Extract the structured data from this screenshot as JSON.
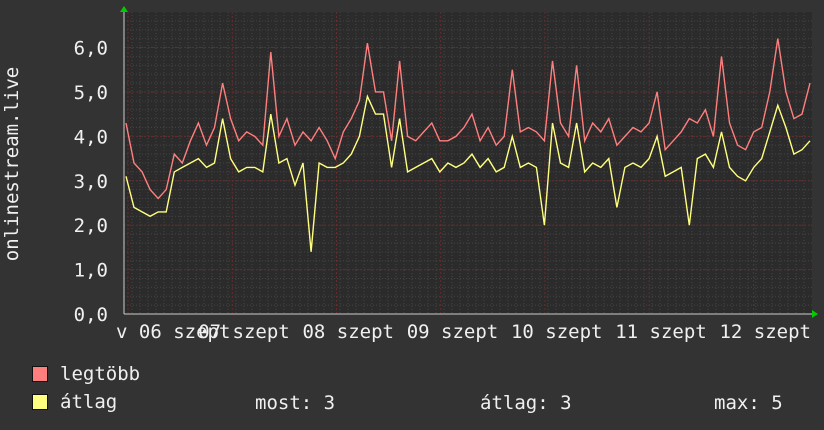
{
  "colors": {
    "background": "#333333",
    "plot_background": "#2b2b2b",
    "grid_major": "#6a2a2a",
    "grid_minor": "#444444",
    "axis_arrow": "#00cc00",
    "series_max": "#ff7f7f",
    "series_avg": "#ffff7f",
    "text": "#f0f0f0"
  },
  "chart_data": {
    "type": "line",
    "ylabel": "onlinestream.live",
    "ylim": [
      0,
      6.8
    ],
    "y_ticks": [
      "0,0",
      "1,0",
      "2,0",
      "3,0",
      "4,0",
      "5,0",
      "6,0"
    ],
    "y_tick_values": [
      0,
      1,
      2,
      3,
      4,
      5,
      6
    ],
    "x_tick_labels": [
      "v 06 szept",
      "07 szept",
      "08 szept",
      "09 szept",
      "10 szept",
      "11 szept",
      "12 szept"
    ],
    "grid": true,
    "series": [
      {
        "name": "legtöbb",
        "color": "#ff7f7f",
        "values": [
          4.3,
          3.4,
          3.2,
          2.8,
          2.6,
          2.8,
          3.6,
          3.4,
          3.9,
          4.3,
          3.8,
          4.2,
          5.2,
          4.4,
          3.9,
          4.1,
          4.0,
          3.8,
          5.9,
          4.0,
          4.4,
          3.8,
          4.1,
          3.9,
          4.2,
          3.9,
          3.5,
          4.1,
          4.4,
          4.8,
          6.1,
          5.0,
          5.0,
          3.9,
          5.7,
          4.0,
          3.9,
          4.1,
          4.3,
          3.9,
          3.9,
          4.0,
          4.2,
          4.5,
          3.9,
          4.2,
          3.8,
          4.0,
          5.5,
          4.1,
          4.2,
          4.1,
          3.9,
          5.7,
          4.3,
          4.0,
          5.6,
          3.9,
          4.3,
          4.1,
          4.4,
          3.8,
          4.0,
          4.2,
          4.1,
          4.3,
          5.0,
          3.7,
          3.9,
          4.1,
          4.4,
          4.3,
          4.6,
          4.0,
          5.8,
          4.3,
          3.8,
          3.7,
          4.1,
          4.2,
          5.0,
          6.2,
          5.0,
          4.4,
          4.5,
          5.2
        ]
      },
      {
        "name": "átlag",
        "color": "#ffff7f",
        "values": [
          3.1,
          2.4,
          2.3,
          2.2,
          2.3,
          2.3,
          3.2,
          3.3,
          3.4,
          3.5,
          3.3,
          3.4,
          4.4,
          3.5,
          3.2,
          3.3,
          3.3,
          3.2,
          4.5,
          3.4,
          3.5,
          2.9,
          3.4,
          1.4,
          3.4,
          3.3,
          3.3,
          3.4,
          3.6,
          4.0,
          4.9,
          4.5,
          4.5,
          3.3,
          4.4,
          3.2,
          3.3,
          3.4,
          3.5,
          3.2,
          3.4,
          3.3,
          3.4,
          3.6,
          3.3,
          3.5,
          3.2,
          3.3,
          4.0,
          3.3,
          3.4,
          3.3,
          2.0,
          4.3,
          3.4,
          3.3,
          4.3,
          3.2,
          3.4,
          3.3,
          3.5,
          2.4,
          3.3,
          3.4,
          3.3,
          3.5,
          4.0,
          3.1,
          3.2,
          3.3,
          2.0,
          3.5,
          3.6,
          3.3,
          4.1,
          3.3,
          3.1,
          3.0,
          3.3,
          3.5,
          4.1,
          4.7,
          4.2,
          3.6,
          3.7,
          3.9
        ]
      }
    ]
  },
  "legend": {
    "max_label": "legtöbb",
    "avg_label": "átlag"
  },
  "stats": {
    "now": "most: 3",
    "avg": "átlag: 3",
    "max": "max: 5"
  }
}
